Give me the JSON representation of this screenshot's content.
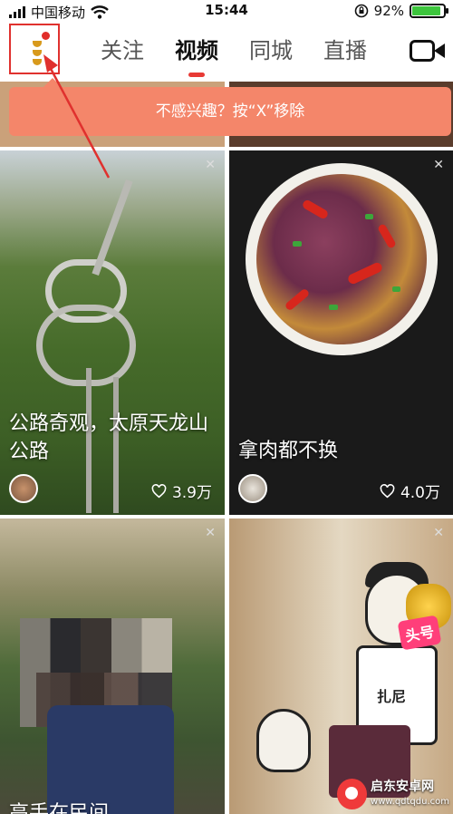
{
  "status_bar": {
    "carrier": "中国移动",
    "time": "15:44",
    "battery_percent": "92%",
    "battery_level": 0.92,
    "wifi_icon": "wifi-icon",
    "lock_icon": "rotation-lock-icon"
  },
  "header": {
    "tabs": [
      {
        "label": "关注"
      },
      {
        "label": "视频"
      },
      {
        "label": "同城"
      },
      {
        "label": "直播"
      }
    ],
    "active_tab": "视频",
    "accent_color": "#e83a35",
    "camera_icon": "video-camera-icon"
  },
  "tooltip": {
    "text": "不感兴趣？按“X”移除",
    "color": "#f4866a"
  },
  "feed": {
    "cards": [
      {
        "title": "公路奇观，太原天龙山公路",
        "likes": "3.9万"
      },
      {
        "title": "拿肉都不换",
        "likes": "4.0万"
      },
      {
        "title": "高手在民间"
      },
      {
        "title": ""
      }
    ]
  },
  "watermark": {
    "name": "启东安卓网",
    "url": "www.qdtqdu.com"
  }
}
